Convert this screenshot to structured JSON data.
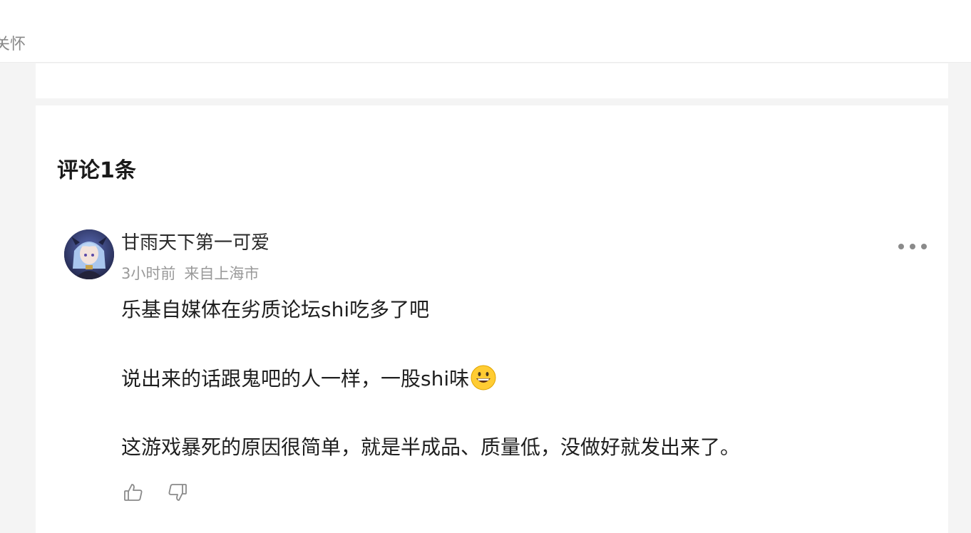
{
  "header": {
    "partial_text": "关怀"
  },
  "comments": {
    "title": "评论1条",
    "items": [
      {
        "username": "甘雨天下第一可爱",
        "time": "3小时前",
        "location": "来自上海市",
        "avatar_icon": "user-avatar",
        "paragraphs": [
          "乐基自媒体在劣质论坛shi吃多了吧",
          "说出来的话跟鬼吧的人一样，一股shi味",
          "这游戏暴死的原因很简单，就是半成品、质量低，没做好就发出来了。"
        ],
        "emoji": "grinning-face",
        "actions": {
          "like_icon": "thumbs-up-icon",
          "dislike_icon": "thumbs-down-icon",
          "more_icon": "more-dots-icon"
        }
      }
    ]
  },
  "colors": {
    "background": "#f4f4f4",
    "card": "#ffffff",
    "muted_text": "#9a9a9a",
    "icon": "#8a8a8a"
  }
}
